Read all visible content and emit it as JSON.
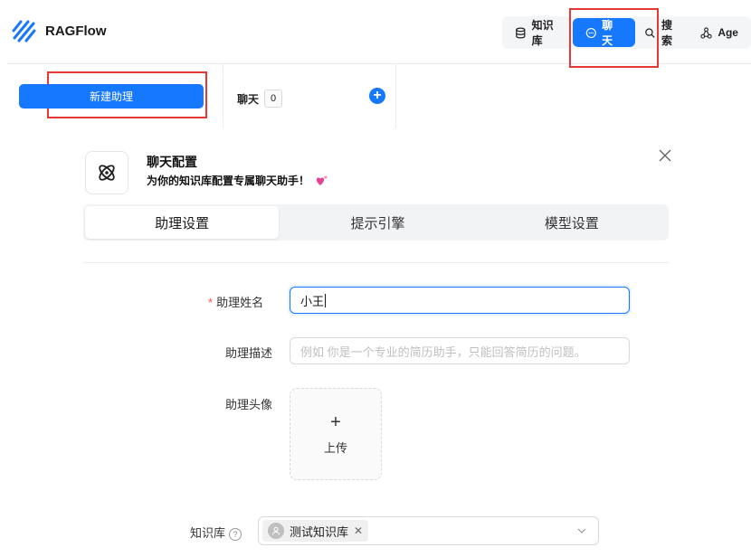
{
  "header": {
    "app_name": "RAGFlow",
    "nav": [
      {
        "label": "知识库",
        "icon": "database-icon"
      },
      {
        "label": "聊天",
        "icon": "chat-bubble-icon",
        "active": true
      },
      {
        "label": "搜索",
        "icon": "search-icon"
      },
      {
        "label": "Age",
        "icon": "agent-graph-icon"
      }
    ]
  },
  "toolbar": {
    "new_assistant": "新建助理",
    "chat_label": "聊天",
    "chat_count": "0"
  },
  "modal": {
    "title": "聊天配置",
    "subtitle": "为你的知识库配置专属聊天助手！",
    "tabs": [
      "助理设置",
      "提示引擎",
      "模型设置"
    ],
    "active_tab": "助理设置"
  },
  "form": {
    "name_label": "助理姓名",
    "name_value": "小王",
    "desc_label": "助理描述",
    "desc_placeholder": "例如 你是一个专业的简历助手，只能回答简历的问题。",
    "avatar_label": "助理头像",
    "upload_label": "上传",
    "kb_label": "知识库",
    "kb_selected": "测试知识库"
  },
  "colors": {
    "accent": "#1677ff",
    "highlight_box": "#e53935",
    "required": "#ff4d4f"
  }
}
